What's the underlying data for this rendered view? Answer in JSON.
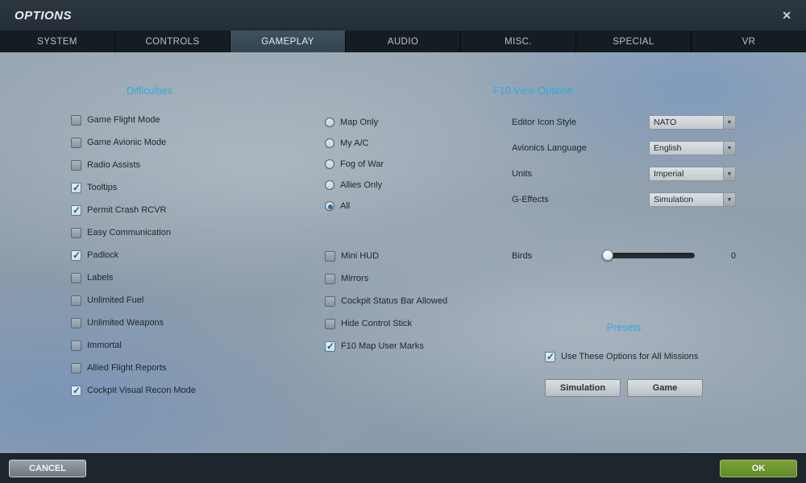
{
  "titlebar": {
    "title": "OPTIONS",
    "close_icon": "✕"
  },
  "tabs": {
    "items": [
      {
        "label": "SYSTEM",
        "active": false
      },
      {
        "label": "CONTROLS",
        "active": false
      },
      {
        "label": "GAMEPLAY",
        "active": true
      },
      {
        "label": "AUDIO",
        "active": false
      },
      {
        "label": "MISC.",
        "active": false
      },
      {
        "label": "SPECIAL",
        "active": false
      },
      {
        "label": "VR",
        "active": false
      }
    ]
  },
  "difficulties": {
    "header": "Difficulties",
    "items": [
      {
        "label": "Game Flight Mode",
        "checked": false
      },
      {
        "label": "Game Avionic Mode",
        "checked": false
      },
      {
        "label": "Radio Assists",
        "checked": false
      },
      {
        "label": "Tooltips",
        "checked": true
      },
      {
        "label": "Permit Crash RCVR",
        "checked": true
      },
      {
        "label": "Easy Communication",
        "checked": false
      },
      {
        "label": "Padlock",
        "checked": true
      },
      {
        "label": "Labels",
        "checked": false
      },
      {
        "label": "Unlimited Fuel",
        "checked": false
      },
      {
        "label": "Unlimited Weapons",
        "checked": false
      },
      {
        "label": "Immortal",
        "checked": false
      },
      {
        "label": "Allied Flight Reports",
        "checked": false
      },
      {
        "label": "Cockpit Visual Recon Mode",
        "checked": true
      }
    ]
  },
  "map_view": {
    "radios": [
      {
        "label": "Map Only",
        "selected": false
      },
      {
        "label": "My A/C",
        "selected": false
      },
      {
        "label": "Fog of War",
        "selected": false
      },
      {
        "label": "Allies Only",
        "selected": false
      },
      {
        "label": "All",
        "selected": true
      }
    ],
    "checks": [
      {
        "label": "Mini HUD",
        "checked": false
      },
      {
        "label": "Mirrors",
        "checked": false
      },
      {
        "label": "Cockpit Status Bar Allowed",
        "checked": false
      },
      {
        "label": "Hide Control Stick",
        "checked": false
      },
      {
        "label": "F10 Map User Marks",
        "checked": true
      }
    ]
  },
  "f10_view": {
    "header": "F10 View Options",
    "dropdowns": [
      {
        "label": "Editor Icon Style",
        "value": "NATO"
      },
      {
        "label": "Avionics Language",
        "value": "English"
      },
      {
        "label": "Units",
        "value": "Imperial"
      },
      {
        "label": "G-Effects",
        "value": "Simulation"
      }
    ],
    "birds": {
      "label": "Birds",
      "value": "0"
    },
    "dropdown_arrow": "▼"
  },
  "presets": {
    "header": "Presets",
    "use_all": {
      "label": "Use These Options for All Missions",
      "checked": true
    },
    "buttons": [
      {
        "label": "Simulation"
      },
      {
        "label": "Game"
      }
    ]
  },
  "footer": {
    "cancel_label": "CANCEL",
    "ok_label": "OK"
  },
  "colors": {
    "accent": "#35a7dc",
    "ok_green": "#6f9a33"
  }
}
